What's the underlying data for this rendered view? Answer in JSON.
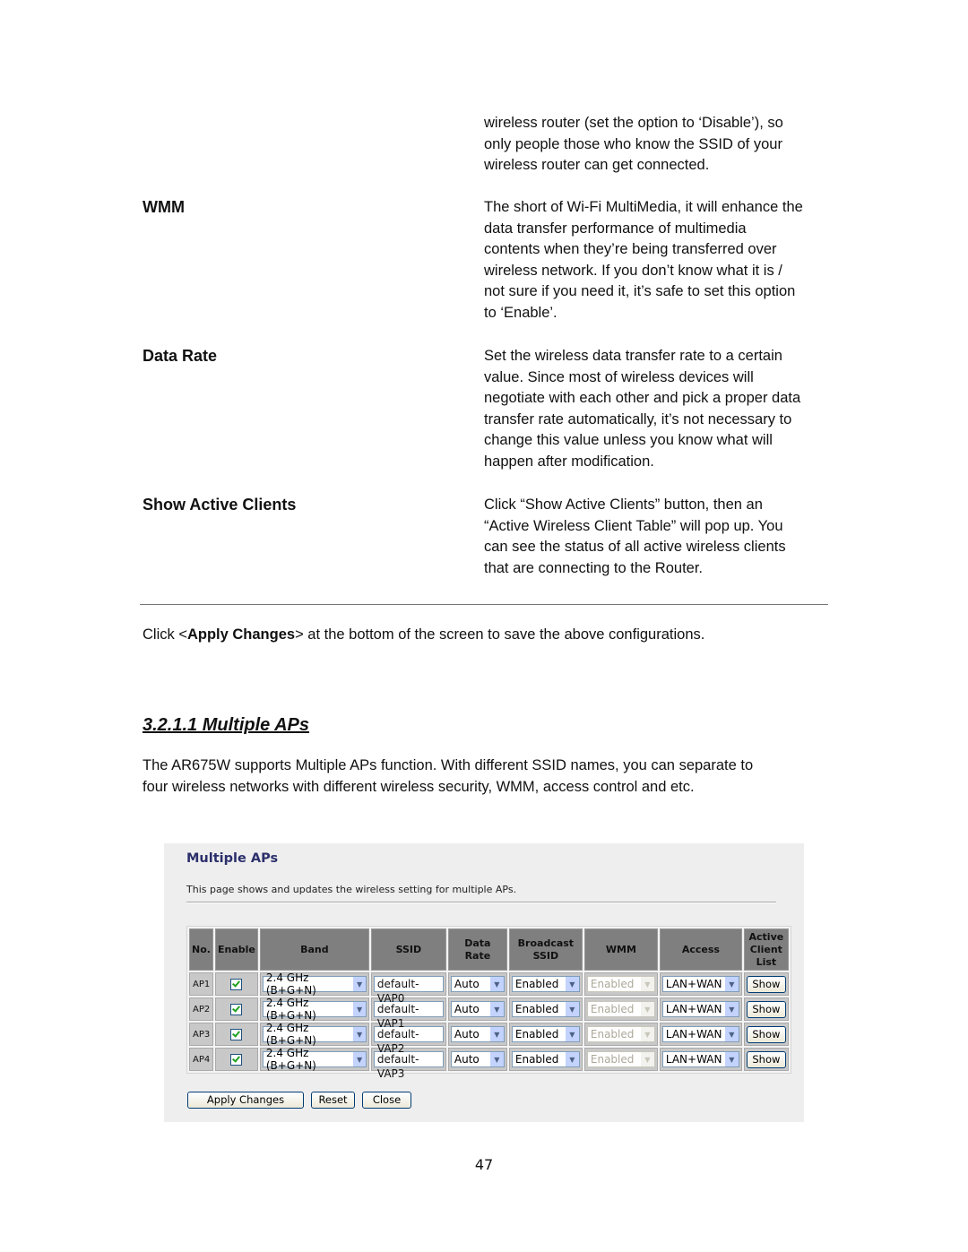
{
  "definitions": [
    {
      "term": "",
      "lines": [
        "wireless router (set the option to ‘Disable’), so",
        "only people those who know the SSID of your",
        "wireless router can get connected."
      ]
    },
    {
      "term": "WMM",
      "lines": [
        "The short of Wi-Fi MultiMedia, it will enhance the",
        "data transfer performance of multimedia",
        "contents when they’re being transferred over",
        "wireless network. If you don’t know what it is /",
        "not sure if you need it, it’s safe to set this option",
        "to ‘Enable’."
      ]
    },
    {
      "term": "Data Rate",
      "lines": [
        "Set the wireless data transfer rate to a certain",
        "value. Since most of wireless devices will",
        "negotiate with each other and pick a proper data",
        "transfer rate automatically, it’s not necessary to",
        "change this value unless you know what will",
        "happen after modification."
      ]
    },
    {
      "term": "Show Active Clients",
      "lines": [
        "Click “Show Active Clients” button, then an",
        "“Active Wireless Client Table” will pop up. You",
        "can see the status of all active wireless clients",
        "that are connecting to the Router."
      ]
    }
  ],
  "apply_note": {
    "prefix": "Click <",
    "bold": "Apply Changes",
    "suffix": "> at the bottom of the screen to save the above configurations."
  },
  "section": {
    "title": "3.2.1.1 Multiple APs",
    "intro_lines": [
      "The AR675W supports Multiple APs function. With different SSID names, you can separate to",
      "four wireless networks with different wireless security, WMM, access control and etc."
    ]
  },
  "screenshot": {
    "title": "Multiple APs",
    "description": "This page shows and updates the wireless setting for multiple APs.",
    "columns": [
      "No.",
      "Enable",
      "Band",
      "SSID",
      "Data Rate",
      "Broadcast SSID",
      "WMM",
      "Access",
      "Active Client List"
    ],
    "rows": [
      {
        "no": "AP1",
        "enabled": true,
        "band": "2.4 GHz (B+G+N)",
        "ssid": "default-VAP0",
        "data_rate": "Auto",
        "broadcast_ssid": "Enabled",
        "wmm": "Enabled",
        "access": "LAN+WAN",
        "client_list_button": "Show"
      },
      {
        "no": "AP2",
        "enabled": true,
        "band": "2.4 GHz (B+G+N)",
        "ssid": "default-VAP1",
        "data_rate": "Auto",
        "broadcast_ssid": "Enabled",
        "wmm": "Enabled",
        "access": "LAN+WAN",
        "client_list_button": "Show"
      },
      {
        "no": "AP3",
        "enabled": true,
        "band": "2.4 GHz (B+G+N)",
        "ssid": "default-VAP2",
        "data_rate": "Auto",
        "broadcast_ssid": "Enabled",
        "wmm": "Enabled",
        "access": "LAN+WAN",
        "client_list_button": "Show"
      },
      {
        "no": "AP4",
        "enabled": true,
        "band": "2.4 GHz (B+G+N)",
        "ssid": "default-VAP3",
        "data_rate": "Auto",
        "broadcast_ssid": "Enabled",
        "wmm": "Enabled",
        "access": "LAN+WAN",
        "client_list_button": "Show"
      }
    ],
    "buttons": {
      "apply": "Apply Changes",
      "reset": "Reset",
      "close": "Close"
    },
    "colors": {
      "title": "#2b2f6b",
      "header_bg": "#7f7f7f",
      "cell_bg": "#c8c8c8",
      "panel_bg": "#eeeeee"
    }
  },
  "page_number": "47"
}
